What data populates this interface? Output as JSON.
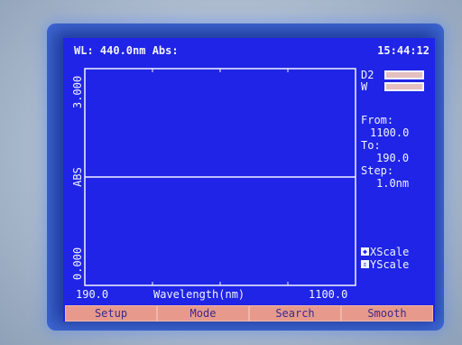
{
  "header": {
    "wl_label": "WL: 440.0nm Abs:",
    "time": "15:44:12"
  },
  "lamps": [
    {
      "label": "D2"
    },
    {
      "label": "W"
    }
  ],
  "range": {
    "from_label": "From:",
    "from_value": "1100.0",
    "to_label": "To:",
    "to_value": "190.0",
    "step_label": "Step:",
    "step_value": "1.0nm"
  },
  "scale_buttons": [
    {
      "label": "XScale"
    },
    {
      "label": "YScale"
    }
  ],
  "softkeys": [
    {
      "label": "Setup"
    },
    {
      "label": "Mode"
    },
    {
      "label": "Search"
    },
    {
      "label": "Smooth"
    }
  ],
  "chart_data": {
    "type": "line",
    "xlabel": "Wavelength(nm)",
    "ylabel": "ABS",
    "x_tick_left": "190.0",
    "x_tick_right": "1100.0",
    "y_tick_top": "3.000",
    "y_tick_bottom": "0.000",
    "xlim": [
      190.0,
      1100.0
    ],
    "ylim": [
      0.0,
      3.0
    ],
    "series": [
      {
        "x": [
          190.0,
          1100.0
        ],
        "y": [
          1.5,
          1.5
        ]
      }
    ],
    "colors": {
      "line": "#f2f4ff",
      "background": "#1f24e6"
    }
  }
}
